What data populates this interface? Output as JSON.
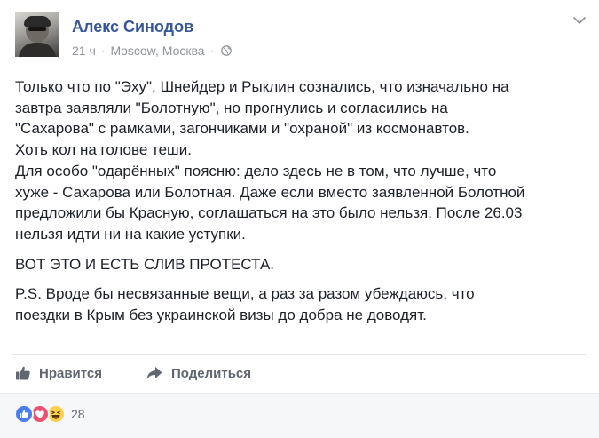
{
  "post": {
    "author": "Алекс Синодов",
    "time": "21 ч",
    "separator": "·",
    "location": "Moscow, Москва",
    "privacy_icon": "globe-icon",
    "menu_icon": "chevron-down-icon",
    "paragraphs": [
      [
        "Только что по \"Эху\", Шнейдер и Рыклин сознались, что изначально на",
        "завтра заявляли \"Болотную\", но прогнулись и согласились на",
        "\"Сахарова\" с рамками, загончиками и \"охраной\" из космонавтов.",
        "Хоть кол на голове теши.",
        "Для особо \"одарённых\" поясню: дело здесь не в том, что лучше, что",
        "хуже - Сахарова или Болотная. Даже если вместо заявленной Болотной",
        "предложили бы Красную, соглашаться на это было нельзя. После 26.03",
        "нельзя идти ни на какие уступки."
      ],
      [
        "ВОТ ЭТО И ЕСТЬ СЛИВ ПРОТЕСТА."
      ],
      [
        "P.S. Вроде бы несвязанные вещи, а раз за разом убеждаюсь, что",
        "поездки в Крым без украинской визы до добра не доводят."
      ]
    ]
  },
  "actions": {
    "like_label": "Нравится",
    "like_icon": "thumbs-up-icon",
    "share_label": "Поделиться",
    "share_icon": "share-arrow-icon"
  },
  "reactions": {
    "icons": [
      "like-reaction-icon",
      "love-reaction-icon",
      "haha-reaction-icon"
    ],
    "count": "28",
    "colors": {
      "like": "#4a7df0",
      "love": "#f0506e",
      "haha": "#fcd04d"
    }
  },
  "colors": {
    "author": "#365899",
    "meta": "#90949c",
    "text": "#1d2129",
    "action": "#616770",
    "footer_bg": "#f6f7f9"
  }
}
